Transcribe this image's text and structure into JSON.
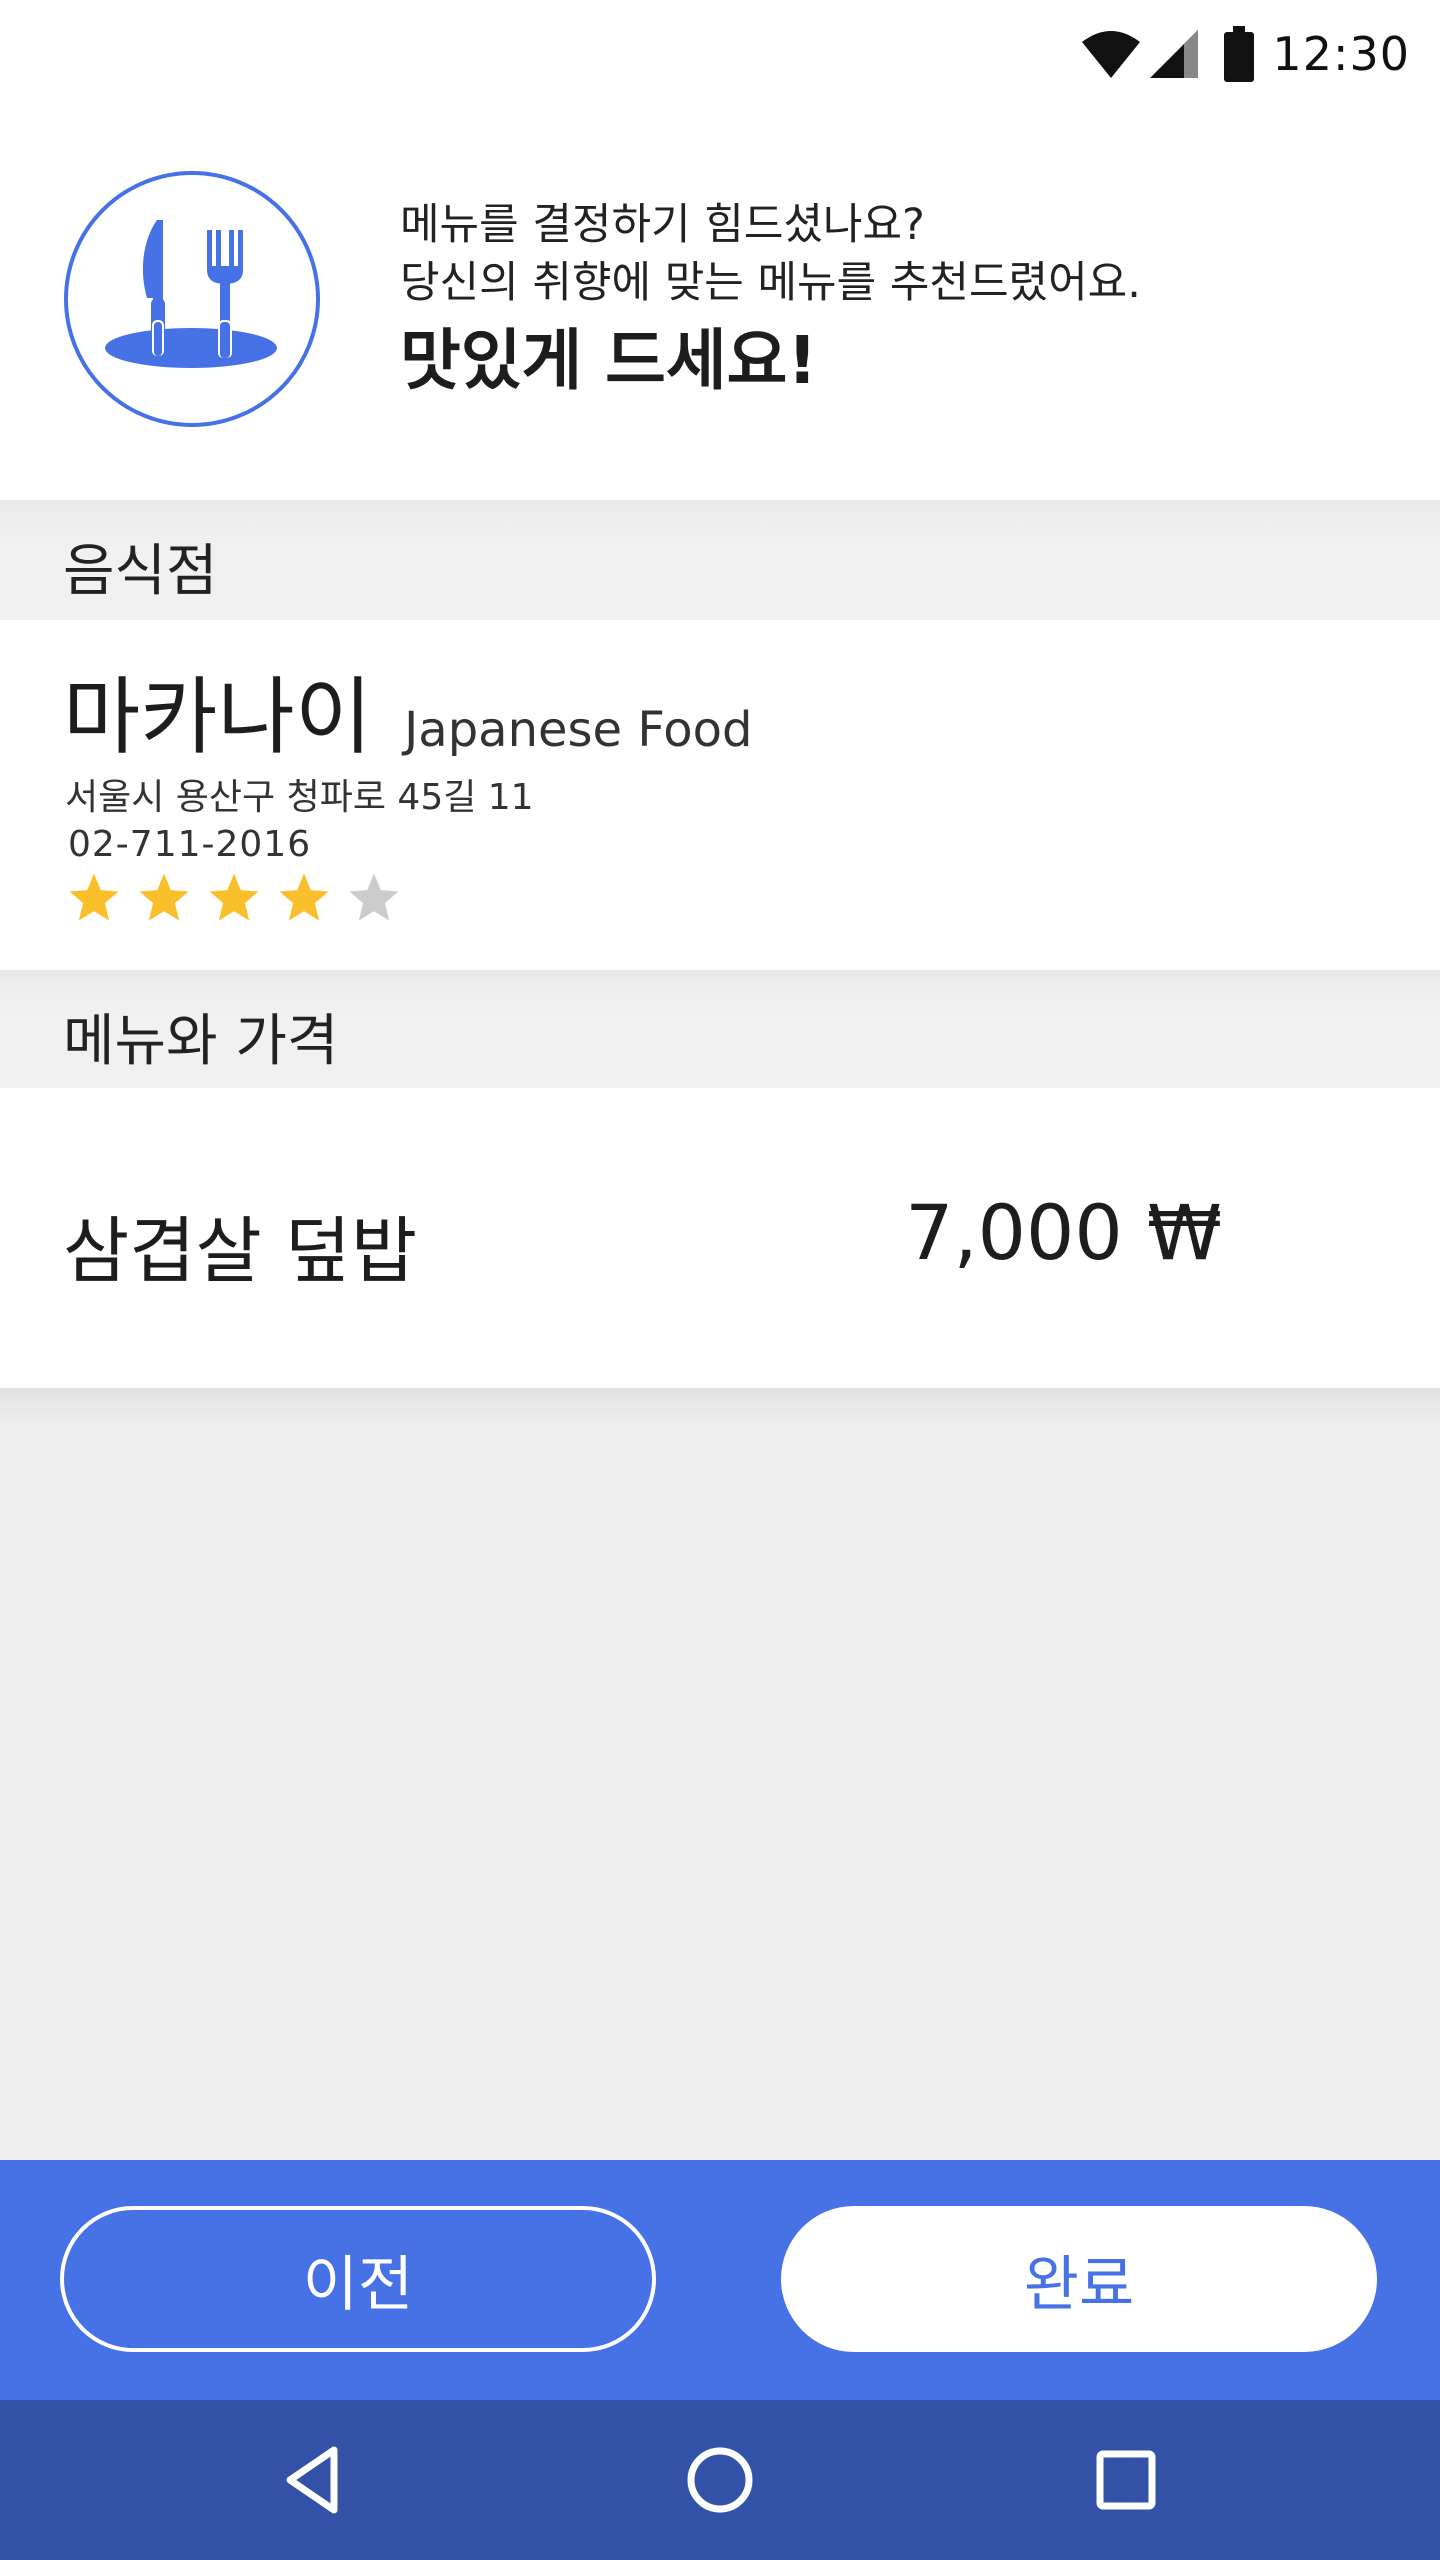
{
  "status_bar": {
    "time": "12:30",
    "icons": [
      "wifi-icon",
      "cell-signal-icon",
      "battery-icon"
    ]
  },
  "header": {
    "logo_icon": "knife-fork-plate-icon",
    "line1": "메뉴를 결정하기 힘드셨나요?",
    "line2": "당신의 취향에 맞는 메뉴를 추천드렸어요.",
    "line3": "맛있게 드세요!"
  },
  "restaurant_section": {
    "title": "음식점",
    "name": "마카나이",
    "category": "Japanese Food",
    "address": "서울시 용산구 청파로 45길 11",
    "phone": "02-711-2016",
    "rating": 4,
    "rating_max": 5
  },
  "menu_section": {
    "title": "메뉴와 가격",
    "items": [
      {
        "name": "삼겹살 덮밥",
        "price": "7,000 ₩"
      }
    ]
  },
  "actions": {
    "prev_label": "이전",
    "done_label": "완료"
  },
  "nav": {
    "icons": [
      "back-triangle-icon",
      "home-circle-icon",
      "recents-square-icon"
    ]
  },
  "colors": {
    "accent": "#4672e6",
    "nav_bar": "#3451a8",
    "star_filled": "#f9c02b",
    "star_empty": "#cccccc",
    "background": "#efefef"
  }
}
